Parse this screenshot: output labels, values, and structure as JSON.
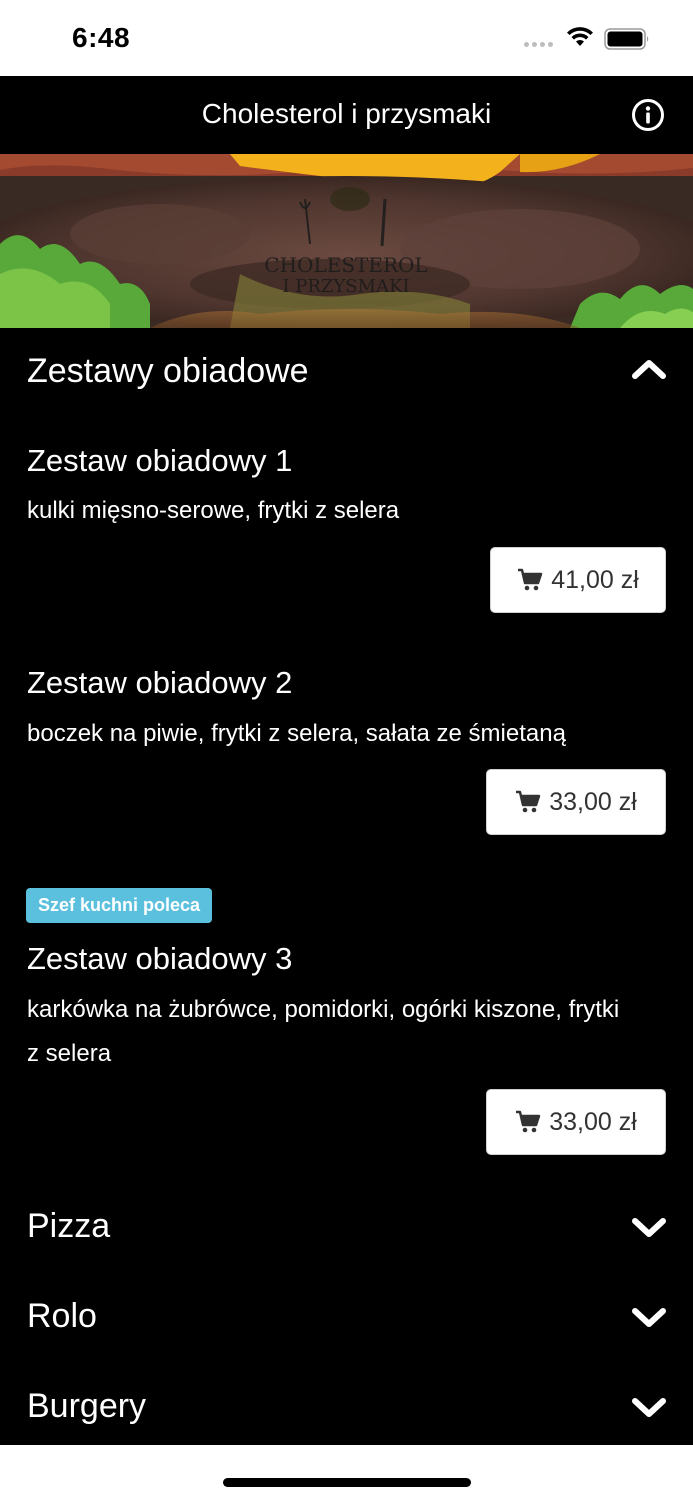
{
  "status_bar": {
    "time": "6:48"
  },
  "nav": {
    "title": "Cholesterol i przysmaki",
    "info_icon": "info-icon"
  },
  "hero": {
    "logo_line1": "CHOLESTEROL",
    "logo_line2": "I PRZYSMAKI"
  },
  "sections": [
    {
      "title": "Zestawy obiadowe",
      "expanded": true,
      "items": [
        {
          "title": "Zestaw obiadowy 1",
          "description": "kulki mięsno-serowe, frytki z selera",
          "price": "41,00 zł"
        },
        {
          "title": "Zestaw obiadowy 2",
          "description": "boczek na piwie, frytki z selera, sałata ze śmietaną",
          "price": "33,00 zł"
        },
        {
          "badge": "Szef kuchni poleca",
          "title": "Zestaw obiadowy 3",
          "description": "karkówka na żubrówce, pomidorki, ogórki kiszone, frytki z selera",
          "price": "33,00 zł"
        }
      ]
    },
    {
      "title": "Pizza",
      "expanded": false
    },
    {
      "title": "Rolo",
      "expanded": false
    },
    {
      "title": "Burgery",
      "expanded": false
    }
  ],
  "colors": {
    "background": "#000000",
    "badge": "#5bc0de",
    "button_bg": "#ffffff",
    "button_text": "#333333"
  }
}
